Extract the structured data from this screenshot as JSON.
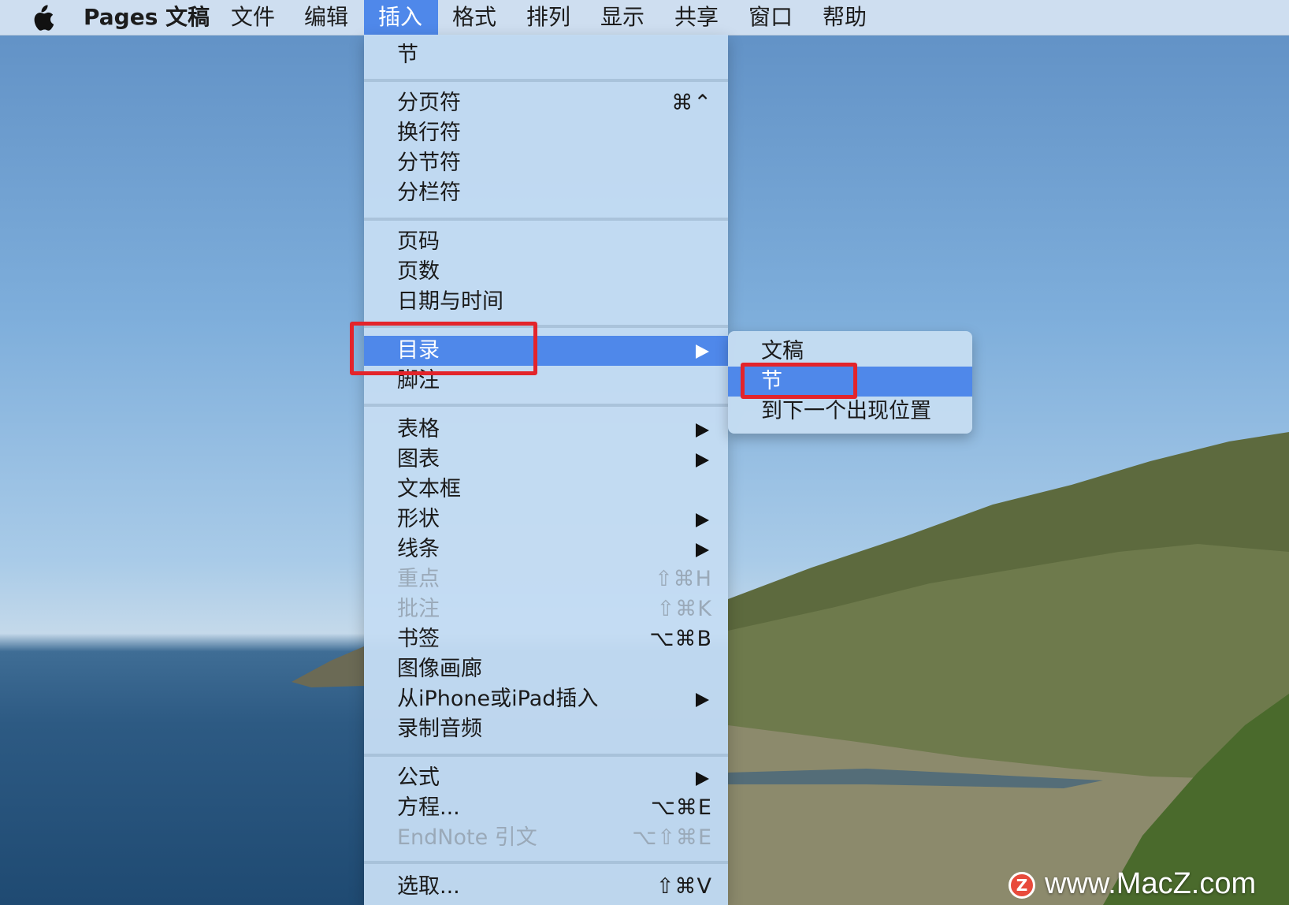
{
  "menubar": {
    "apple_icon": "apple-icon",
    "items": [
      {
        "label": "Pages 文稿"
      },
      {
        "label": "文件"
      },
      {
        "label": "编辑"
      },
      {
        "label": "插入"
      },
      {
        "label": "格式"
      },
      {
        "label": "排列"
      },
      {
        "label": "显示"
      },
      {
        "label": "共享"
      },
      {
        "label": "窗口"
      },
      {
        "label": "帮助"
      }
    ],
    "active_item": "插入"
  },
  "insert_menu": {
    "items": [
      {
        "label": "节",
        "shortcut": ""
      },
      {
        "label": "分页符",
        "shortcut": "⌘⌃"
      },
      {
        "label": "换行符",
        "shortcut": ""
      },
      {
        "label": "分节符",
        "shortcut": ""
      },
      {
        "label": "分栏符",
        "shortcut": ""
      },
      {
        "label": "页码",
        "shortcut": ""
      },
      {
        "label": "页数",
        "shortcut": ""
      },
      {
        "label": "日期与时间",
        "shortcut": ""
      },
      {
        "label": "目录",
        "shortcut": "",
        "submenu": true,
        "selected": true
      },
      {
        "label": "脚注",
        "shortcut": ""
      },
      {
        "label": "表格",
        "submenu": true
      },
      {
        "label": "图表",
        "submenu": true
      },
      {
        "label": "文本框"
      },
      {
        "label": "形状",
        "submenu": true
      },
      {
        "label": "线条",
        "submenu": true
      },
      {
        "label": "重点",
        "shortcut": "⇧⌘H",
        "disabled": true
      },
      {
        "label": "批注",
        "shortcut": "⇧⌘K",
        "disabled": true
      },
      {
        "label": "书签",
        "shortcut": "⌥⌘B"
      },
      {
        "label": "图像画廊"
      },
      {
        "label": "从iPhone或iPad插入",
        "submenu": true
      },
      {
        "label": "录制音频"
      },
      {
        "label": "公式",
        "submenu": true
      },
      {
        "label": "方程...",
        "shortcut": "⌥⌘E"
      },
      {
        "label": "EndNote 引文",
        "shortcut": "⌥⇧⌘E",
        "disabled": true
      },
      {
        "label": "选取...",
        "shortcut": "⇧⌘V"
      }
    ]
  },
  "toc_submenu": {
    "items": [
      {
        "label": "文稿"
      },
      {
        "label": "节",
        "selected": true
      },
      {
        "label": "到下一个出现位置"
      }
    ]
  },
  "watermark": {
    "badge": "Z",
    "text": "www.MacZ.com"
  },
  "colors": {
    "selection": "#4f88ea",
    "highlight_box": "#e3242b",
    "menu_bg": "#c4dcf2",
    "disabled_text": "#9aa9b8"
  }
}
